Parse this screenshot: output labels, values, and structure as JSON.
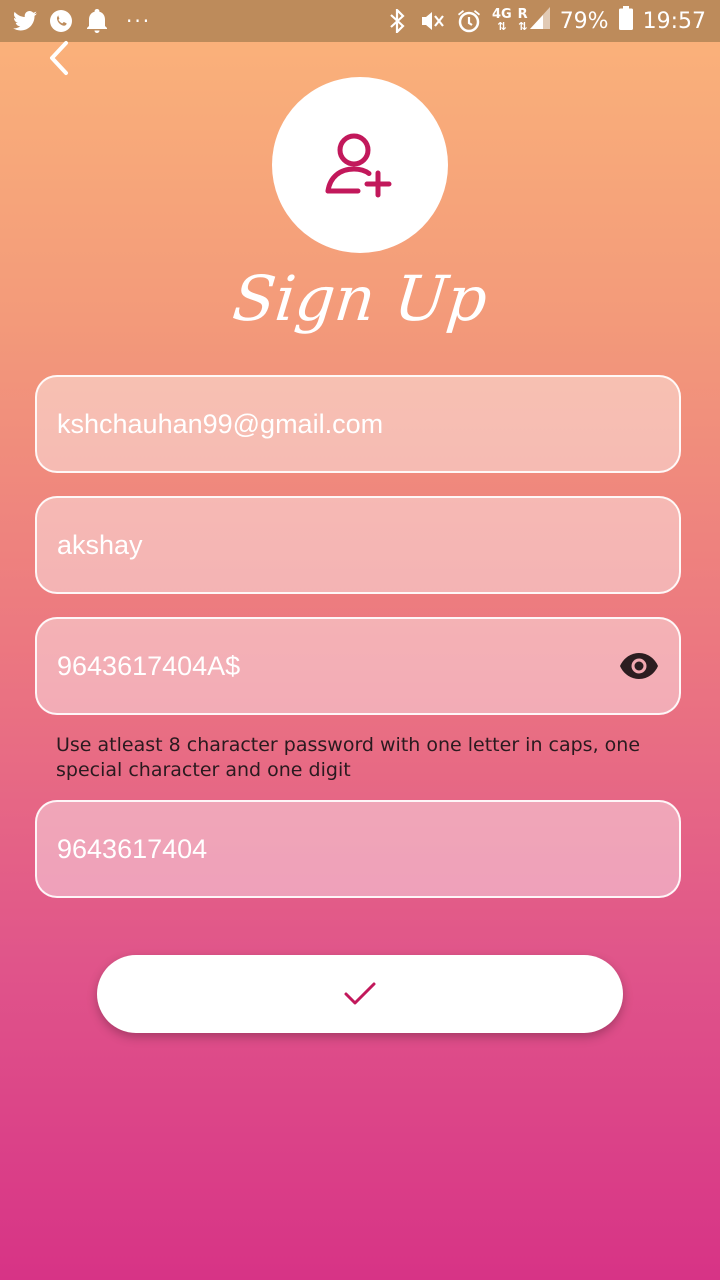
{
  "status_bar": {
    "icons_left": [
      "twitter-icon",
      "whatsapp-icon",
      "bell-icon"
    ],
    "overflow": "···",
    "icons_right": [
      "bluetooth-icon",
      "mute-icon",
      "alarm-icon"
    ],
    "network_top": "4G",
    "network_r": "R",
    "battery": "79%",
    "time": "19:57"
  },
  "header": {
    "title": "Sign Up"
  },
  "form": {
    "email_value": "kshchauhan99@gmail.com",
    "name_value": "akshay",
    "password_value": "9643617404A$",
    "password_hint": "Use atleast 8 character password with one letter in caps, one special character and one digit",
    "phone_value": "9643617404"
  },
  "colors": {
    "accent": "#c2185b",
    "gradient_top": "#fbb47a",
    "gradient_bottom": "#d73386",
    "status_bar": "#bd8b5b"
  }
}
